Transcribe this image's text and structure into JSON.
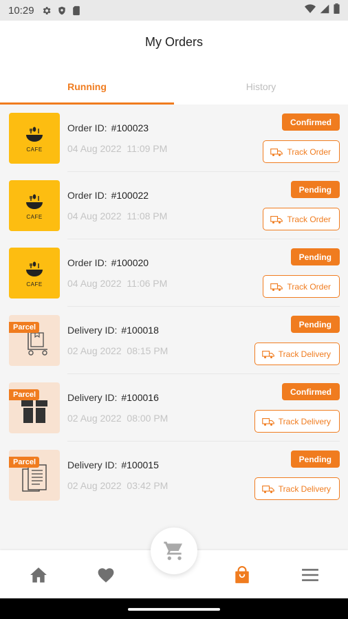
{
  "status_bar": {
    "time": "10:29"
  },
  "header": {
    "title": "My Orders"
  },
  "tabs": [
    {
      "label": "Running",
      "active": true
    },
    {
      "label": "History",
      "active": false
    }
  ],
  "orders": [
    {
      "kind": "cafe",
      "id_label": "Order ID:",
      "id": "#100023",
      "date": "04 Aug 2022",
      "time": "11:09 PM",
      "status": "Confirmed",
      "action": "Track Order"
    },
    {
      "kind": "cafe",
      "id_label": "Order ID:",
      "id": "#100022",
      "date": "04 Aug 2022",
      "time": "11:08 PM",
      "status": "Pending",
      "action": "Track Order"
    },
    {
      "kind": "cafe",
      "id_label": "Order ID:",
      "id": "#100020",
      "date": "04 Aug 2022",
      "time": "11:06 PM",
      "status": "Pending",
      "action": "Track Order"
    },
    {
      "kind": "parcel",
      "tag": "Parcel",
      "icon": "trolley-icon",
      "id_label": "Delivery ID:",
      "id": "#100018",
      "date": "02 Aug 2022",
      "time": "08:15 PM",
      "status": "Pending",
      "action": "Track Delivery"
    },
    {
      "kind": "parcel",
      "tag": "Parcel",
      "icon": "gift-box-icon",
      "id_label": "Delivery ID:",
      "id": "#100016",
      "date": "02 Aug 2022",
      "time": "08:00 PM",
      "status": "Confirmed",
      "action": "Track Delivery"
    },
    {
      "kind": "parcel",
      "tag": "Parcel",
      "icon": "documents-icon",
      "id_label": "Delivery ID:",
      "id": "#100015",
      "date": "02 Aug 2022",
      "time": "03:42 PM",
      "status": "Pending",
      "action": "Track Delivery"
    }
  ],
  "cafe_logo_text": "CAFE",
  "bottom_nav": [
    {
      "icon": "home-icon",
      "active": false
    },
    {
      "icon": "heart-icon",
      "active": false
    },
    {
      "icon": "cart-icon",
      "active": false
    },
    {
      "icon": "shopping-bag-icon",
      "active": true
    },
    {
      "icon": "menu-icon",
      "active": false
    }
  ],
  "colors": {
    "accent": "#f07c1f",
    "cafe_bg": "#fdbd11",
    "parcel_bg": "#f8e2d1",
    "muted_text": "#c4c4c4"
  }
}
